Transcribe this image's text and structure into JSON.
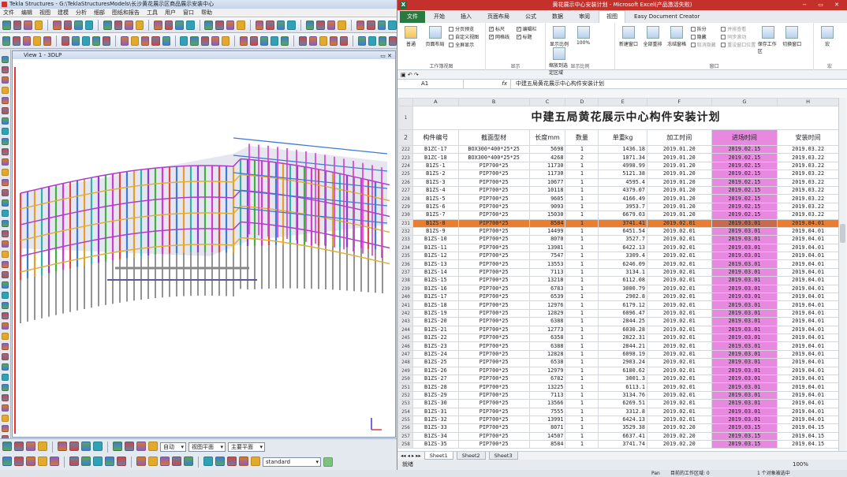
{
  "tekla": {
    "title": "Tekla Structures - G:\\TeklaStructuresModels\\长沙黄花展示区商品展示安装中心",
    "menu": [
      "文件",
      "编辑",
      "视图",
      "建模",
      "分析",
      "细部",
      "图纸和报告",
      "工具",
      "用户",
      "窗口",
      "帮助"
    ],
    "view_title": "View 1 - 3DLP",
    "bottom_combos": {
      "auto": "自动",
      "view_plane": "视图平面",
      "main_plane": "主要平面",
      "standard": "standard"
    }
  },
  "excel": {
    "title": "黄花展示中心安装计划 - Microsoft Excel(产品激活失败)",
    "ribbon_tabs": [
      "文件",
      "开始",
      "插入",
      "页面布局",
      "公式",
      "数据",
      "审阅",
      "视图",
      "Easy Document Creator"
    ],
    "ribbon": {
      "workbook_views": {
        "normal": "普通",
        "page_layout": "页面布局",
        "page_break": "分页预览",
        "custom_views": "自定义视图",
        "full_screen": "全屏显示",
        "label": "工作簿视图"
      },
      "show": {
        "ruler": "标尺",
        "gridlines": "网格线",
        "formula_bar": "编辑栏",
        "headings": "标题",
        "label": "显示"
      },
      "zoom": {
        "zoom": "显示比例",
        "hundred": "100%",
        "zoom_to_selection": "缩放到选定区域",
        "label": "显示比例"
      },
      "window": {
        "new_window": "新建窗口",
        "arrange_all": "全部重排",
        "freeze": "冻结窗格",
        "split": "拆分",
        "hide": "隐藏",
        "unhide": "取消隐藏",
        "side_by_side": "并排查看",
        "sync_scroll": "同步滚动",
        "reset_position": "重设窗口位置",
        "save_workspace": "保存工作区",
        "switch_window": "切换窗口",
        "label": "窗口"
      },
      "macro": {
        "macro": "宏",
        "label": "宏"
      }
    },
    "name_box": "A1",
    "formula": "中建五局黄花展示中心构件安装计划",
    "columns": [
      "A",
      "B",
      "C",
      "D",
      "E",
      "F",
      "G",
      "H"
    ],
    "sheet_title": "中建五局黄花展示中心构件安装计划",
    "headers": [
      "构件编号",
      "截面型材",
      "长度mm",
      "数量",
      "单重kg",
      "加工时间",
      "进场时间",
      "安装时间"
    ],
    "rows": [
      {
        "n": "222",
        "id": "B1ZC-17",
        "sec": "BOX300*400*25*25",
        "len": "5698",
        "qty": "1",
        "wt": "1436.18",
        "p": "2019.01.20",
        "a": "2019.02.15",
        "i": "2019.03.22"
      },
      {
        "n": "223",
        "id": "B1ZC-18",
        "sec": "BOX300*400*25*25",
        "len": "4268",
        "qty": "2",
        "wt": "1071.34",
        "p": "2019.01.20",
        "a": "2019.02.15",
        "i": "2019.03.22"
      },
      {
        "n": "224",
        "id": "B1ZS-1",
        "sec": "PIP700*25",
        "len": "11730",
        "qty": "1",
        "wt": "4998.99",
        "p": "2019.01.20",
        "a": "2019.02.15",
        "i": "2019.03.22"
      },
      {
        "n": "225",
        "id": "B1ZS-2",
        "sec": "PIP700*25",
        "len": "11730",
        "qty": "1",
        "wt": "5121.38",
        "p": "2019.01.20",
        "a": "2019.02.15",
        "i": "2019.03.22"
      },
      {
        "n": "226",
        "id": "B1ZS-3",
        "sec": "PIP700*25",
        "len": "10677",
        "qty": "1",
        "wt": "4595.4",
        "p": "2019.01.20",
        "a": "2019.02.15",
        "i": "2019.03.22"
      },
      {
        "n": "227",
        "id": "B1ZS-4",
        "sec": "PIP700*25",
        "len": "10118",
        "qty": "1",
        "wt": "4379.07",
        "p": "2019.01.20",
        "a": "2019.02.15",
        "i": "2019.03.22"
      },
      {
        "n": "228",
        "id": "B1ZS-5",
        "sec": "PIP700*25",
        "len": "9605",
        "qty": "1",
        "wt": "4166.49",
        "p": "2019.01.20",
        "a": "2019.02.15",
        "i": "2019.03.22"
      },
      {
        "n": "229",
        "id": "B1ZS-6",
        "sec": "PIP700*25",
        "len": "9093",
        "qty": "1",
        "wt": "3953.7",
        "p": "2019.01.20",
        "a": "2019.02.15",
        "i": "2019.03.22"
      },
      {
        "n": "230",
        "id": "B1ZS-7",
        "sec": "PIP700*25",
        "len": "15030",
        "qty": "1",
        "wt": "6679.03",
        "p": "2019.01.20",
        "a": "2019.02.15",
        "i": "2019.03.22"
      },
      {
        "n": "231",
        "id": "B1ZS-8",
        "sec": "PIP700*25",
        "len": "8584",
        "qty": "1",
        "wt": "3741.41",
        "p": "2019.02.01",
        "a": "2019.03.01",
        "i": "2019.04.01",
        "hl": true
      },
      {
        "n": "232",
        "id": "B1ZS-9",
        "sec": "PIP700*25",
        "len": "14499",
        "qty": "1",
        "wt": "6451.54",
        "p": "2019.02.01",
        "a": "2019.03.01",
        "i": "2019.04.01"
      },
      {
        "n": "233",
        "id": "B1ZS-10",
        "sec": "PIP700*25",
        "len": "8070",
        "qty": "1",
        "wt": "3527.7",
        "p": "2019.02.01",
        "a": "2019.03.01",
        "i": "2019.04.01"
      },
      {
        "n": "234",
        "id": "B1ZS-11",
        "sec": "PIP700*25",
        "len": "13981",
        "qty": "1",
        "wt": "6422.13",
        "p": "2019.02.01",
        "a": "2019.03.01",
        "i": "2019.04.01"
      },
      {
        "n": "235",
        "id": "B1ZS-12",
        "sec": "PIP700*25",
        "len": "7547",
        "qty": "1",
        "wt": "3309.4",
        "p": "2019.02.01",
        "a": "2019.03.01",
        "i": "2019.04.01"
      },
      {
        "n": "236",
        "id": "B1ZS-13",
        "sec": "PIP700*25",
        "len": "13553",
        "qty": "1",
        "wt": "6246.09",
        "p": "2019.02.01",
        "a": "2019.03.01",
        "i": "2019.04.01"
      },
      {
        "n": "237",
        "id": "B1ZS-14",
        "sec": "PIP700*25",
        "len": "7113",
        "qty": "1",
        "wt": "3134.1",
        "p": "2019.02.01",
        "a": "2019.03.01",
        "i": "2019.04.01"
      },
      {
        "n": "238",
        "id": "B1ZS-15",
        "sec": "PIP700*25",
        "len": "13218",
        "qty": "1",
        "wt": "6112.08",
        "p": "2019.02.01",
        "a": "2019.03.01",
        "i": "2019.04.01"
      },
      {
        "n": "239",
        "id": "B1ZS-16",
        "sec": "PIP700*25",
        "len": "6783",
        "qty": "1",
        "wt": "3000.79",
        "p": "2019.02.01",
        "a": "2019.03.01",
        "i": "2019.04.01"
      },
      {
        "n": "240",
        "id": "B1ZS-17",
        "sec": "PIP700*25",
        "len": "6539",
        "qty": "1",
        "wt": "2902.8",
        "p": "2019.02.01",
        "a": "2019.03.01",
        "i": "2019.04.01"
      },
      {
        "n": "241",
        "id": "B1ZS-18",
        "sec": "PIP700*25",
        "len": "12976",
        "qty": "1",
        "wt": "6179.12",
        "p": "2019.02.01",
        "a": "2019.03.01",
        "i": "2019.04.01"
      },
      {
        "n": "242",
        "id": "B1ZS-19",
        "sec": "PIP700*25",
        "len": "12829",
        "qty": "1",
        "wt": "6096.47",
        "p": "2019.02.01",
        "a": "2019.03.01",
        "i": "2019.04.01"
      },
      {
        "n": "243",
        "id": "B1ZS-20",
        "sec": "PIP700*25",
        "len": "6388",
        "qty": "1",
        "wt": "2844.25",
        "p": "2019.02.01",
        "a": "2019.03.01",
        "i": "2019.04.01"
      },
      {
        "n": "244",
        "id": "B1ZS-21",
        "sec": "PIP700*25",
        "len": "12773",
        "qty": "1",
        "wt": "6030.28",
        "p": "2019.02.01",
        "a": "2019.03.01",
        "i": "2019.04.01"
      },
      {
        "n": "245",
        "id": "B1ZS-22",
        "sec": "PIP700*25",
        "len": "6358",
        "qty": "1",
        "wt": "2822.31",
        "p": "2019.02.01",
        "a": "2019.03.01",
        "i": "2019.04.01"
      },
      {
        "n": "246",
        "id": "B1ZS-23",
        "sec": "PIP700*25",
        "len": "6388",
        "qty": "1",
        "wt": "2844.21",
        "p": "2019.02.01",
        "a": "2019.03.01",
        "i": "2019.04.01"
      },
      {
        "n": "247",
        "id": "B1ZS-24",
        "sec": "PIP700*25",
        "len": "12828",
        "qty": "1",
        "wt": "6098.19",
        "p": "2019.02.01",
        "a": "2019.03.01",
        "i": "2019.04.01"
      },
      {
        "n": "248",
        "id": "B1ZS-25",
        "sec": "PIP700*25",
        "len": "6538",
        "qty": "1",
        "wt": "2903.24",
        "p": "2019.02.01",
        "a": "2019.03.01",
        "i": "2019.04.01"
      },
      {
        "n": "249",
        "id": "B1ZS-26",
        "sec": "PIP700*25",
        "len": "12979",
        "qty": "1",
        "wt": "6180.62",
        "p": "2019.02.01",
        "a": "2019.03.01",
        "i": "2019.04.01"
      },
      {
        "n": "250",
        "id": "B1ZS-27",
        "sec": "PIP700*25",
        "len": "6782",
        "qty": "1",
        "wt": "3001.3",
        "p": "2019.02.01",
        "a": "2019.03.01",
        "i": "2019.04.01"
      },
      {
        "n": "251",
        "id": "B1ZS-28",
        "sec": "PIP700*25",
        "len": "13225",
        "qty": "1",
        "wt": "6113.1",
        "p": "2019.02.01",
        "a": "2019.03.01",
        "i": "2019.04.01"
      },
      {
        "n": "252",
        "id": "B1ZS-29",
        "sec": "PIP700*25",
        "len": "7113",
        "qty": "1",
        "wt": "3134.76",
        "p": "2019.02.01",
        "a": "2019.03.01",
        "i": "2019.04.01"
      },
      {
        "n": "253",
        "id": "B1ZS-30",
        "sec": "PIP700*25",
        "len": "13566",
        "qty": "1",
        "wt": "6269.51",
        "p": "2019.02.01",
        "a": "2019.03.01",
        "i": "2019.04.01"
      },
      {
        "n": "254",
        "id": "B1ZS-31",
        "sec": "PIP700*25",
        "len": "7555",
        "qty": "1",
        "wt": "3312.8",
        "p": "2019.02.01",
        "a": "2019.03.01",
        "i": "2019.04.01"
      },
      {
        "n": "255",
        "id": "B1ZS-32",
        "sec": "PIP700*25",
        "len": "13991",
        "qty": "1",
        "wt": "6424.13",
        "p": "2019.02.01",
        "a": "2019.03.01",
        "i": "2019.04.01"
      },
      {
        "n": "256",
        "id": "B1ZS-33",
        "sec": "PIP700*25",
        "len": "8071",
        "qty": "1",
        "wt": "3529.38",
        "p": "2019.02.20",
        "a": "2019.03.15",
        "i": "2019.04.15"
      },
      {
        "n": "257",
        "id": "B1ZS-34",
        "sec": "PIP700*25",
        "len": "14507",
        "qty": "1",
        "wt": "6637.41",
        "p": "2019.02.20",
        "a": "2019.03.15",
        "i": "2019.04.15"
      },
      {
        "n": "258",
        "id": "B1ZS-35",
        "sec": "PIP700*25",
        "len": "8584",
        "qty": "1",
        "wt": "3741.74",
        "p": "2019.02.20",
        "a": "2019.03.15",
        "i": "2019.04.15"
      }
    ],
    "sheets": [
      "Sheet1",
      "Sheet2",
      "Sheet3"
    ],
    "status": "就绪",
    "zoom": "100%"
  },
  "bottom_status": {
    "pan": "Pan",
    "mode": "目前的工作区域: 0",
    "count": "1 个对象被选中"
  },
  "colors": {
    "excel_green": "#1e7145",
    "excel_title": "#c4302b",
    "pink": "#e889e0",
    "highlight": "#ea7e2e"
  }
}
